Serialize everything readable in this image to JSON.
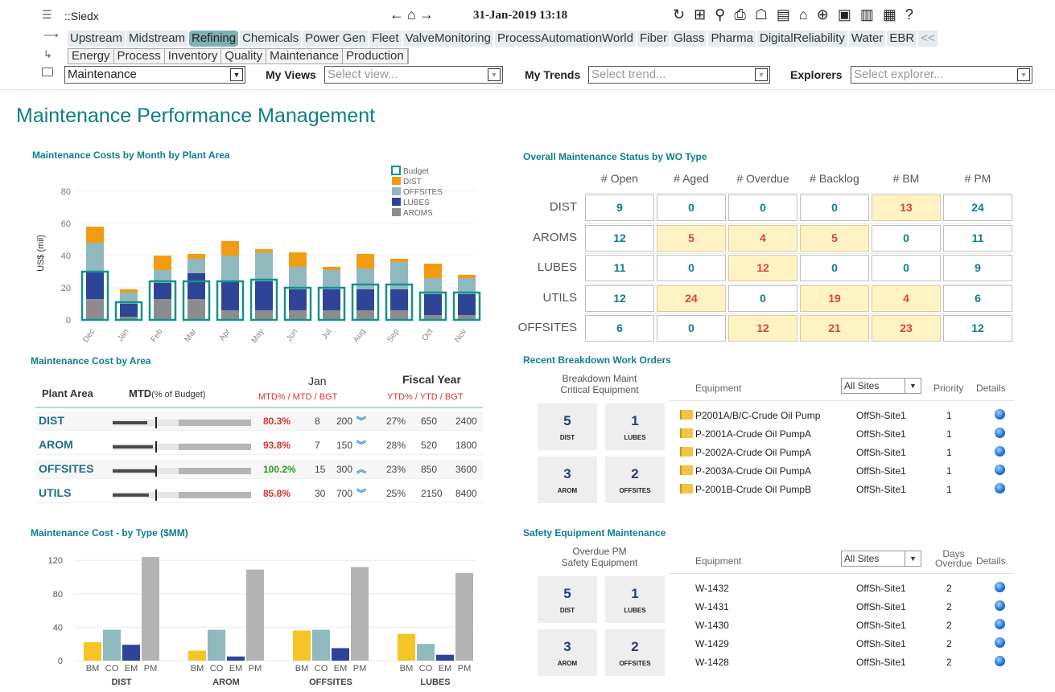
{
  "topbar": {
    "app_name": "::Siedx",
    "datetime": "31-Jan-2019 13:18",
    "nav_glyphs": "←⌂→",
    "tools_glyphs": "↻ ⊞ ⚲ ⎙ ☖ ▤ ⌂ ⊕ ▣ ▥ ▦ ?",
    "tabs": [
      "Upstream",
      "Midstream",
      "Refining",
      "Chemicals",
      "Power Gen",
      "Fleet",
      "ValveMonitoring",
      "ProcessAutomationWorld",
      "Fiber",
      "Glass",
      "Pharma",
      "DigitalReliability",
      "Water",
      "EBR",
      "<<"
    ],
    "selected_tab": "Refining",
    "subtabs": [
      "Energy",
      "Process",
      "Inventory",
      "Quality",
      "Maintenance",
      "Production"
    ],
    "view_select": "Maintenance",
    "my_views_label": "My Views",
    "my_views_placeholder": "Select view...",
    "my_trends_label": "My Trends",
    "my_trends_placeholder": "Select trend...",
    "explorers_label": "Explorers",
    "explorers_placeholder": "Select explorer..."
  },
  "page_title": "Maintenance Performance Management",
  "costs_by_month": {
    "title": "Maintenance Costs by Month by Plant Area"
  },
  "status": {
    "title": "Overall Maintenance Status by WO Type",
    "columns": [
      "# Open",
      "# Aged",
      "# Overdue",
      "# Backlog",
      "# BM",
      "# PM"
    ],
    "rows": [
      {
        "label": "DIST",
        "values": [
          "9",
          "0",
          "0",
          "0",
          "13",
          "24"
        ],
        "hl": [
          false,
          false,
          false,
          false,
          true,
          false
        ]
      },
      {
        "label": "AROMS",
        "values": [
          "12",
          "5",
          "4",
          "5",
          "0",
          "11"
        ],
        "hl": [
          false,
          true,
          true,
          true,
          false,
          false
        ]
      },
      {
        "label": "LUBES",
        "values": [
          "11",
          "0",
          "12",
          "0",
          "0",
          "9"
        ],
        "hl": [
          false,
          false,
          true,
          false,
          false,
          false
        ]
      },
      {
        "label": "UTILS",
        "values": [
          "12",
          "24",
          "0",
          "19",
          "4",
          "6"
        ],
        "hl": [
          false,
          true,
          false,
          true,
          true,
          false
        ]
      },
      {
        "label": "OFFSITES",
        "values": [
          "6",
          "0",
          "12",
          "21",
          "23",
          "12"
        ],
        "hl": [
          false,
          false,
          true,
          true,
          true,
          false
        ]
      }
    ]
  },
  "cost_by_area": {
    "title": "Maintenance Cost by Area",
    "h_area": "Plant Area",
    "h_mtd": "MTD",
    "h_mtd_sub": "(% of Budget)",
    "h_jan": "Jan",
    "h_jan_sub": "MTD% / MTD / BGT",
    "h_fy": "Fiscal Year",
    "h_fy_sub": "YTD% / YTD / BGT",
    "rows": [
      {
        "area": "DIST",
        "pct": "80.3%",
        "mtd": "8",
        "bgt": "200",
        "ytdp": "27%",
        "ytd": "650",
        "fbgt": "2400",
        "dir": "down",
        "color": "#d9342b",
        "frac": 0.803
      },
      {
        "area": "AROM",
        "pct": "93.8%",
        "mtd": "7",
        "bgt": "150",
        "ytdp": "28%",
        "ytd": "520",
        "fbgt": "1800",
        "dir": "down",
        "color": "#d9342b",
        "frac": 0.938
      },
      {
        "area": "OFFSITES",
        "pct": "100.2%",
        "mtd": "15",
        "bgt": "300",
        "ytdp": "23%",
        "ytd": "850",
        "fbgt": "3600",
        "dir": "up",
        "color": "#2a9a2a",
        "frac": 1.002
      },
      {
        "area": "UTILS",
        "pct": "85.8%",
        "mtd": "30",
        "bgt": "700",
        "ytdp": "25%",
        "ytd": "2150",
        "fbgt": "8400",
        "dir": "down",
        "color": "#d9342b",
        "frac": 0.858
      }
    ]
  },
  "breakdown": {
    "title": "Recent Breakdown Work Orders",
    "kpi_title": "Breakdown Maint\nCritical Equipment",
    "kpis": [
      {
        "n": "5",
        "l": "DIST"
      },
      {
        "n": "1",
        "l": "LUBES"
      },
      {
        "n": "3",
        "l": "AROM"
      },
      {
        "n": "2",
        "l": "OFFSITES"
      }
    ],
    "h_equipment": "Equipment",
    "site_filter": "All Sites",
    "h_priority": "Priority",
    "h_details": "Details",
    "rows": [
      {
        "eq": "P2001A/B/C-Crude Oil Pump",
        "site": "OffSh-Site1",
        "p": "1"
      },
      {
        "eq": "P-2001A-Crude Oil PumpA",
        "site": "OffSh-Site1",
        "p": "1"
      },
      {
        "eq": "P-2002A-Crude Oil PumpA",
        "site": "OffSh-Site1",
        "p": "1"
      },
      {
        "eq": "P-2003A-Crude Oil PumpA",
        "site": "OffSh-Site1",
        "p": "1"
      },
      {
        "eq": "P-2001B-Crude Oil PumpB",
        "site": "OffSh-Site1",
        "p": "1"
      }
    ]
  },
  "cost_by_type": {
    "title": "Maintenance Cost - by Type ($MM)"
  },
  "safety": {
    "title": "Safety Equipment Maintenance",
    "kpi_title": "Overdue PM\nSafety Equipment",
    "kpis": [
      {
        "n": "5",
        "l": "DIST"
      },
      {
        "n": "1",
        "l": "LUBES"
      },
      {
        "n": "3",
        "l": "AROM"
      },
      {
        "n": "2",
        "l": "OFFSITES"
      }
    ],
    "h_equipment": "Equipment",
    "site_filter": "All Sites",
    "h_days": "Days\nOverdue",
    "h_details": "Details",
    "rows": [
      {
        "eq": "W-1432",
        "site": "OffSh-Site1",
        "p": "2"
      },
      {
        "eq": "W-1431",
        "site": "OffSh-Site1",
        "p": "2"
      },
      {
        "eq": "W-1430",
        "site": "OffSh-Site1",
        "p": "2"
      },
      {
        "eq": "W-1429",
        "site": "OffSh-Site1",
        "p": "2"
      },
      {
        "eq": "W-1428",
        "site": "OffSh-Site1",
        "p": "2"
      }
    ]
  },
  "chart_data": [
    {
      "type": "bar",
      "title": "Maintenance Costs by Month by Plant Area",
      "ylabel": "US$ (mil)",
      "xlabel": "",
      "ylim": [
        0,
        85
      ],
      "yticks": [
        0,
        20,
        40,
        60,
        80
      ],
      "categories": [
        "Dec",
        "Jan",
        "Feb",
        "Mar",
        "Apr",
        "May",
        "Jun",
        "Jul",
        "Aug",
        "Sep",
        "Oct",
        "Nov"
      ],
      "stacked": true,
      "series": [
        {
          "name": "AROMS",
          "color": "#8c8c8c",
          "values": [
            13,
            2,
            13,
            13,
            6,
            6,
            6,
            6,
            6,
            6,
            3,
            3
          ]
        },
        {
          "name": "LUBES",
          "color": "#2e4597",
          "values": [
            17,
            8,
            10,
            16,
            18,
            18,
            13,
            13,
            13,
            13,
            13,
            13
          ]
        },
        {
          "name": "OFFSITES",
          "color": "#8fb9be",
          "values": [
            18,
            7,
            8,
            9,
            16,
            18,
            14,
            12,
            13,
            17,
            10,
            10
          ]
        },
        {
          "name": "DIST",
          "color": "#f39c12",
          "values": [
            10,
            2,
            9,
            3,
            9,
            2,
            9,
            2,
            9,
            2,
            9,
            2
          ]
        }
      ],
      "budget": {
        "name": "Budget",
        "color": "#13918e",
        "values": [
          30,
          11,
          24,
          24,
          24,
          25,
          20,
          20,
          22,
          22,
          17,
          17
        ]
      },
      "legend": "top-right"
    },
    {
      "type": "bar",
      "title": "Maintenance Cost - by Type ($MM)",
      "ylim": [
        0,
        125
      ],
      "yticks": [
        0,
        40,
        80,
        120
      ],
      "types": [
        "BM",
        "CO",
        "EM",
        "PM"
      ],
      "type_colors": [
        "#f5c426",
        "#8fb9be",
        "#2e4597",
        "#b3b3b3"
      ],
      "groups": [
        {
          "name": "DIST",
          "values": [
            22,
            37,
            19,
            124
          ]
        },
        {
          "name": "AROM",
          "values": [
            12,
            37,
            5,
            109
          ]
        },
        {
          "name": "OFFSITES",
          "values": [
            36,
            37,
            15,
            112
          ]
        },
        {
          "name": "LUBES",
          "values": [
            32,
            20,
            7,
            105
          ]
        }
      ]
    }
  ]
}
